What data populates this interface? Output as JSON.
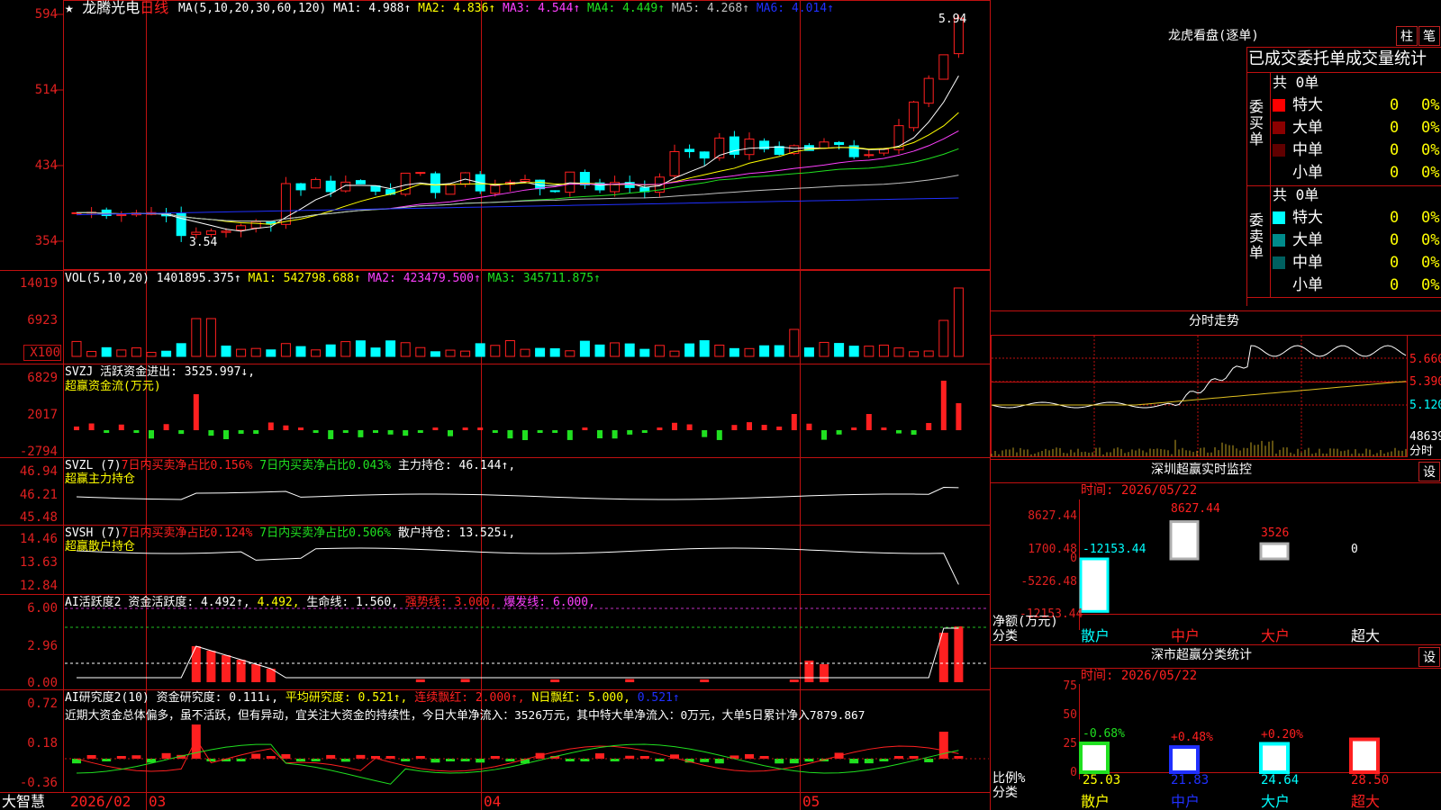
{
  "stock": {
    "name": "龙腾光电",
    "period": "日线",
    "star": "★"
  },
  "ma_line": {
    "prefix": "MA(5,10,20,30,60,120)",
    "ma1": "MA1: 4.988↑",
    "ma2": "MA2: 4.836↑",
    "ma3": "MA3: 4.544↑",
    "ma4": "MA4: 4.449↑",
    "ma5": "MA5: 4.268↑",
    "ma6": "MA6: 4.014↑"
  },
  "price_axis": [
    "594",
    "514",
    "434",
    "354"
  ],
  "price_marks": {
    "high": "5.94",
    "low": "3.54"
  },
  "vol": {
    "prefix": "VOL(5,10,20)",
    "value": "1401895.375↑",
    "ma1": "MA1: 542798.688↑",
    "ma2": "MA2: 423479.500↑",
    "ma3": "MA3: 345711.875↑",
    "axis": [
      "14019",
      "6923",
      "X100"
    ]
  },
  "svzj": {
    "name": "SVZJ",
    "label": "活跃资金进出: 3525.997↓,",
    "sub": "超赢资金流(万元)",
    "axis": [
      "6829",
      "2017",
      "-2794"
    ]
  },
  "svzl": {
    "name": "SVZL (7)",
    "a": "7日内买卖净占比0.156%",
    "b": "7日内买卖净占比0.043%",
    "c": "主力持仓: 46.144↑,",
    "sub": "超赢主力持仓",
    "axis": [
      "46.94",
      "46.21",
      "45.48"
    ]
  },
  "svsh": {
    "name": "SVSH (7)",
    "a": "7日内买卖净占比0.124%",
    "b": "7日内买卖净占比0.506%",
    "c": "散户持仓: 13.525↓,",
    "sub": "超赢散户持仓",
    "axis": [
      "14.46",
      "13.63",
      "12.84"
    ]
  },
  "ai_huoyue": {
    "name": "AI活跃度2",
    "a": "资金活跃度: 4.492↑,",
    "b": "4.492,",
    "c": "生命线: 1.560,",
    "d": "强势线: 3.000,",
    "e": "爆发线: 6.000,",
    "axis": [
      "6.00",
      "2.96",
      "0.00"
    ]
  },
  "ai_yanjiu": {
    "name": "AI研究度2(10)",
    "a": "资金研究度: 0.111↓,",
    "b": "平均研究度: 0.521↑,",
    "c": "连续飘红: 2.000↑,",
    "d": "N日飘红: 5.000,",
    "e": "0.521↑",
    "comment": "近期大资金总体偏多，虽不活跃，但有异动，宜关注大资金的持续性，今日大单净流入：3526万元，其中特大单净流入：0万元，大单5日累计净入7879.867",
    "axis": [
      "0.72",
      "0.18",
      "-0.36"
    ]
  },
  "date_axis": [
    "2026/02",
    "03",
    "04",
    "05"
  ],
  "brand": "大智慧",
  "right": {
    "lhb_title": "龙虎看盘(逐单)",
    "btn_zhu": "柱",
    "btn_bi": "笔",
    "stats_title": "已成交委托单成交量统计",
    "buy_label": "委买单",
    "sell_label": "委卖单",
    "buy_total": "共 0单",
    "sell_total": "共 0单",
    "rows": [
      {
        "name": "特大",
        "val": "0",
        "pct": "0%",
        "buycolor": "#ff0000",
        "sellcolor": "#00ffff"
      },
      {
        "name": "大单",
        "val": "0",
        "pct": "0%",
        "buycolor": "#8b0000",
        "sellcolor": "#008b8b"
      },
      {
        "name": "中单",
        "val": "0",
        "pct": "0%",
        "buycolor": "#600000",
        "sellcolor": "#006060"
      },
      {
        "name": "小单",
        "val": "0",
        "pct": "0%",
        "buycolor": "#000000",
        "sellcolor": "#000000"
      }
    ],
    "fenshi_title": "分时走势",
    "fenshi_axis": [
      "5.660",
      "5.390",
      "5.120",
      "48639",
      "分时"
    ],
    "sz_title": "深圳超赢实时监控",
    "set": "设",
    "sz_time": "时间: 2026/05/22",
    "sz_axis": [
      "8627.44",
      "1700.48",
      "0",
      "-5226.48",
      "-12153.44"
    ],
    "sz_values": [
      "-12153.44",
      "8627.44",
      "3526",
      "0"
    ],
    "sz_ylabel": "净额(万元)",
    "sz_cat_label": "分类",
    "sz_cats": [
      "散户",
      "中户",
      "大户",
      "超大"
    ],
    "fl_title": "深市超赢分类统计",
    "fl_time": "时间: 2026/05/22",
    "fl_axis": [
      "75",
      "50",
      "25",
      "0"
    ],
    "fl_changes": [
      "-0.68%",
      "+0.48%",
      "+0.20%",
      ""
    ],
    "fl_values": [
      "25.03",
      "21.83",
      "24.64",
      "28.50"
    ],
    "fl_ylabel": "比例%",
    "fl_cat_label": "分类",
    "fl_cats": [
      "散户",
      "中户",
      "大户",
      "超大"
    ]
  }
}
